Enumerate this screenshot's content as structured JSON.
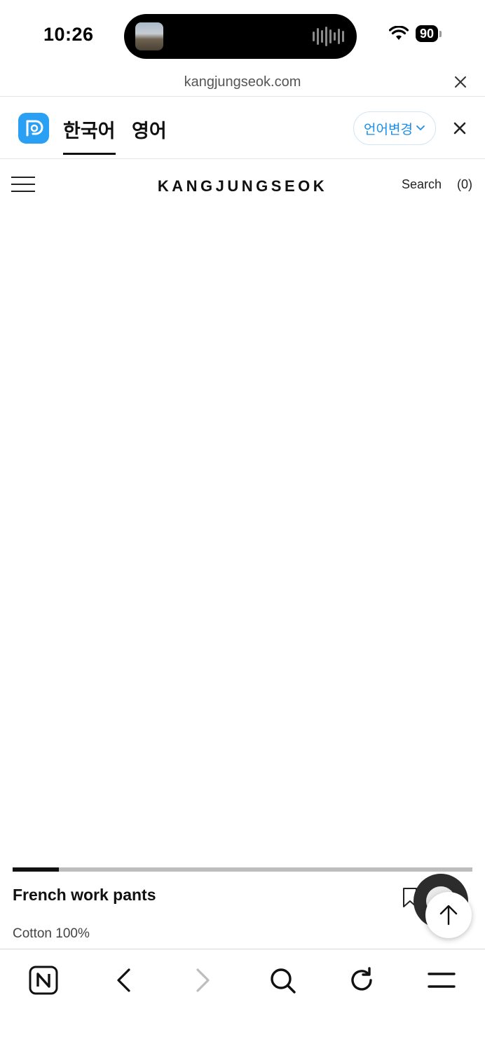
{
  "status_bar": {
    "time": "10:26",
    "battery": "90",
    "icons": [
      "now-playing-thumbnail",
      "audio-wave-icon",
      "wifi-icon",
      "battery-icon"
    ]
  },
  "url_bar": {
    "url": "kangjungseok.com"
  },
  "translate_bar": {
    "tabs": [
      {
        "label": "한국어",
        "active": true
      },
      {
        "label": "영어",
        "active": false
      }
    ],
    "change_language_label": "언어변경",
    "accent_color": "#1a8ee8"
  },
  "site": {
    "brand": "KANGJUNGSEOK",
    "search_label": "Search",
    "cart_label": "(0)"
  },
  "gallery": {
    "background": "#ebebeb",
    "progress_fraction": 0.1
  },
  "product": {
    "name": "French work pants",
    "description": "Cotton 100%"
  },
  "toolbar": {
    "buttons": [
      "naver-home-icon",
      "back-icon",
      "forward-icon",
      "search-icon",
      "refresh-icon",
      "menu-icon"
    ]
  }
}
